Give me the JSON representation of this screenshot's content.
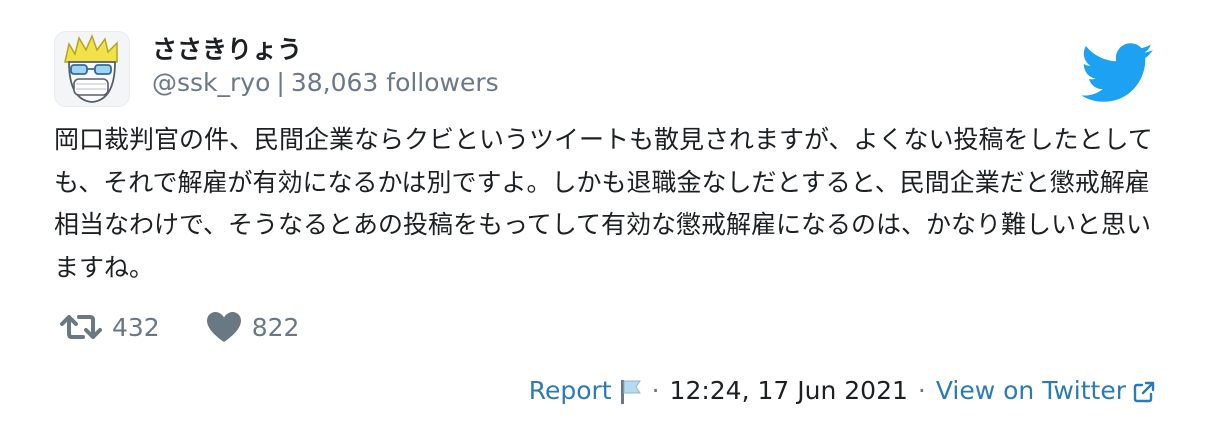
{
  "user": {
    "display_name": "ささきりょう",
    "handle": "@ssk_ryo",
    "separator": "|",
    "followers": "38,063 followers",
    "avatar_icon": "avatar-cartoon-face"
  },
  "brand": {
    "logo_icon": "twitter-bird-icon",
    "color": "#1da1f2"
  },
  "tweet": {
    "text": "岡口裁判官の件、民間企業ならクビというツイートも散見されますが、よくない投稿をしたとしても、それで解雇が有効になるかは別ですよ。しかも退職金なしだとすると、民間企業だと懲戒解雇相当なわけで、そうなるとあの投稿をもってして有効な懲戒解雇になるのは、かなり難しいと思いますね。"
  },
  "actions": {
    "retweet_count": "432",
    "retweet_icon": "retweet-icon",
    "like_count": "822",
    "like_icon": "heart-icon"
  },
  "footer": {
    "report_label": "Report",
    "report_icon": "flag-icon",
    "dot": "·",
    "timestamp": "12:24, 17 Jun 2021",
    "view_label": "View on Twitter",
    "view_icon": "external-link-icon",
    "link_color": "#2b7bb9"
  }
}
